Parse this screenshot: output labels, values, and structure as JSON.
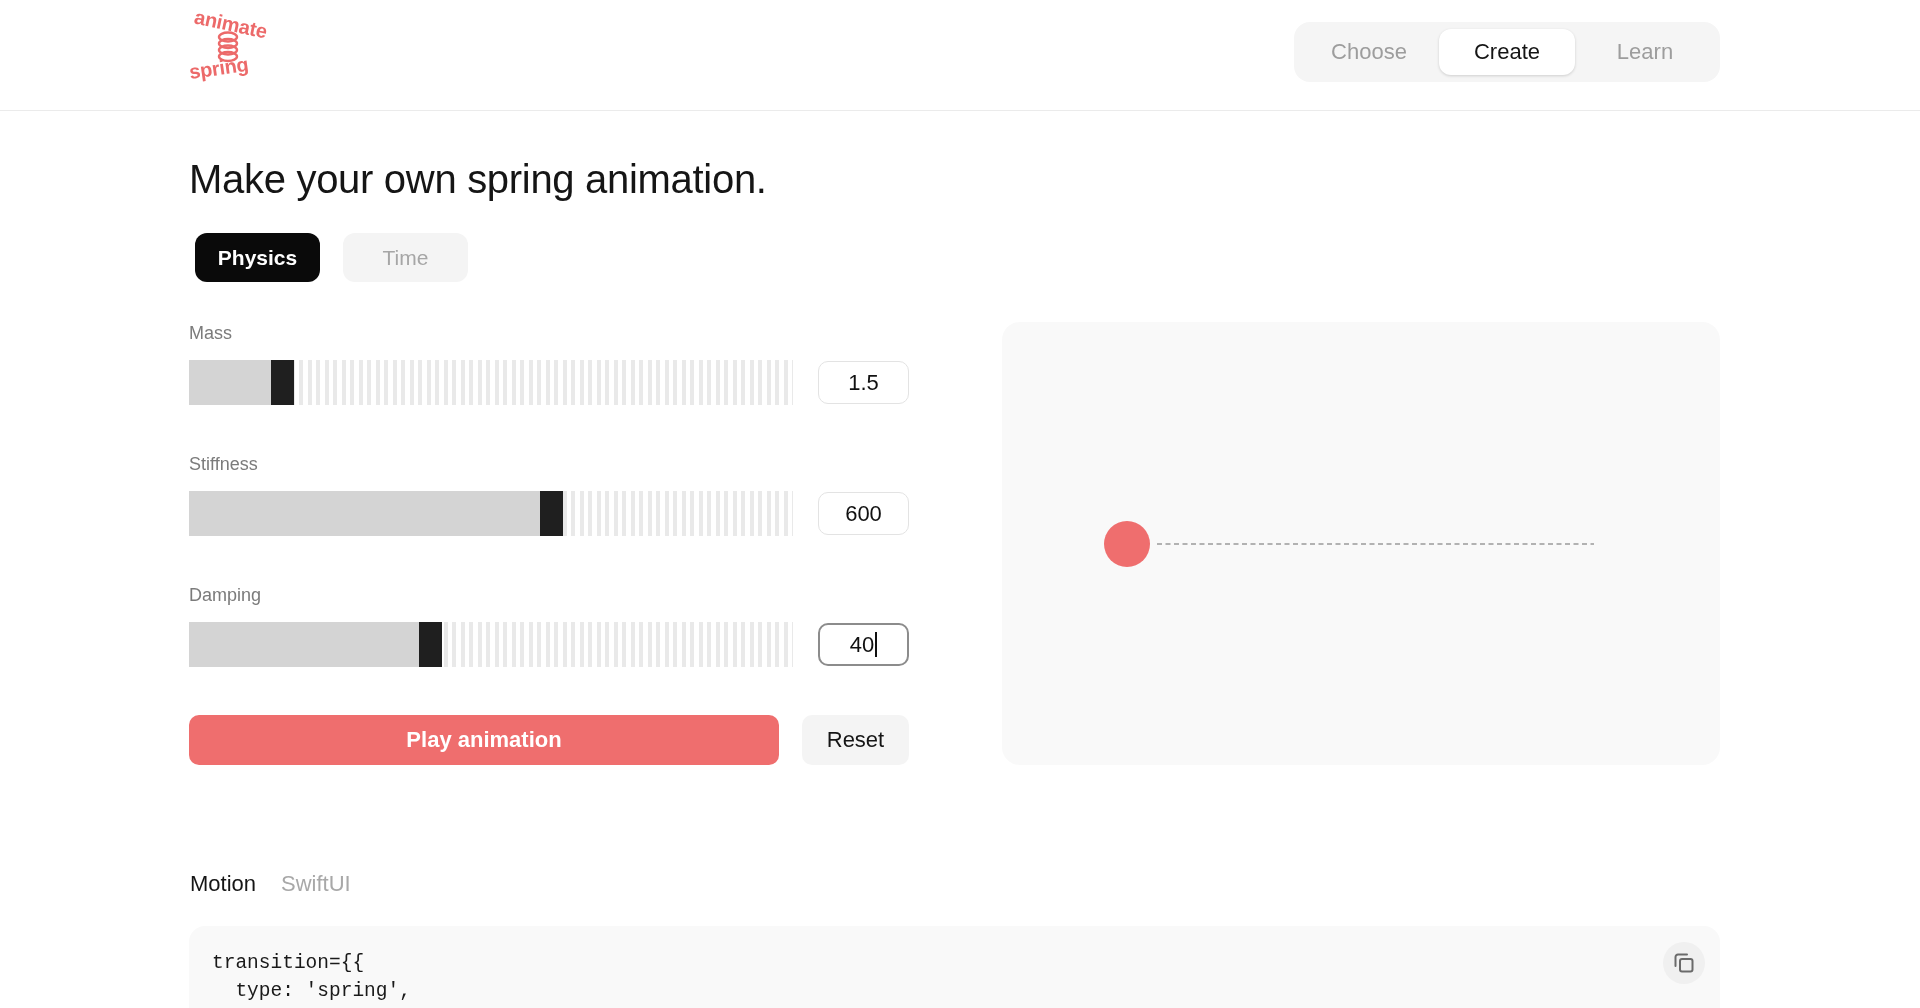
{
  "header": {
    "logo": {
      "top_word": "animate",
      "bottom_word": "spring"
    },
    "nav": [
      {
        "label": "Choose",
        "selected": false
      },
      {
        "label": "Create",
        "selected": true
      },
      {
        "label": "Learn",
        "selected": false
      }
    ]
  },
  "page": {
    "title": "Make your own spring animation.",
    "modes": [
      {
        "label": "Physics",
        "selected": true
      },
      {
        "label": "Time",
        "selected": false
      }
    ],
    "sliders": [
      {
        "label": "Mass",
        "level": 0.155,
        "value": "1.5",
        "focused": false
      },
      {
        "label": "Stiffness",
        "level": 0.6,
        "value": "600",
        "focused": false
      },
      {
        "label": "Damping",
        "level": 0.4,
        "value": "40",
        "focused": true
      }
    ],
    "buttons": [
      {
        "label": "Play animation",
        "kind": "primary"
      },
      {
        "label": "Reset",
        "kind": "secondary"
      }
    ]
  },
  "code": {
    "tabs": [
      {
        "label": "Motion",
        "selected": true
      },
      {
        "label": "SwiftUI",
        "selected": false
      }
    ],
    "lines": [
      "transition={{",
      "  type: 'spring',"
    ]
  }
}
